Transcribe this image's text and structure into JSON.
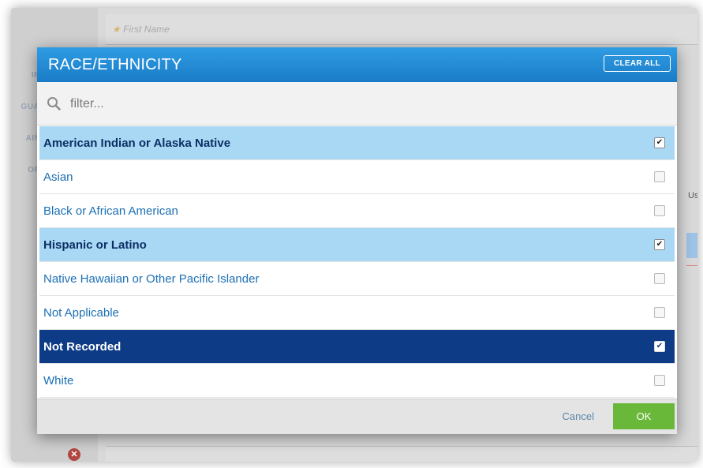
{
  "background": {
    "first_name_placeholder": "First Name",
    "sidebar_items": [
      "IFO",
      "GUAR",
      "AINT",
      "ORY"
    ],
    "side_text": "Used"
  },
  "modal": {
    "title": "RACE/ETHNICITY",
    "clear_all_label": "CLEAR ALL",
    "filter_placeholder": "filter...",
    "options": [
      {
        "label": "American Indian or Alaska Native",
        "checked": true,
        "state": "checked"
      },
      {
        "label": "Asian",
        "checked": false,
        "state": "unchecked"
      },
      {
        "label": "Black or African American",
        "checked": false,
        "state": "unchecked"
      },
      {
        "label": "Hispanic or Latino",
        "checked": true,
        "state": "checked"
      },
      {
        "label": "Native Hawaiian or Other Pacific Islander",
        "checked": false,
        "state": "unchecked"
      },
      {
        "label": "Not Applicable",
        "checked": false,
        "state": "unchecked"
      },
      {
        "label": "Not Recorded",
        "checked": true,
        "state": "active"
      },
      {
        "label": "White",
        "checked": false,
        "state": "unchecked"
      }
    ],
    "cancel_label": "Cancel",
    "ok_label": "OK"
  },
  "colors": {
    "header_blue": "#1a7cc8",
    "selected_row": "#a9d8f5",
    "active_row": "#0d3b86",
    "ok_green": "#6ab83a"
  },
  "icons": {
    "search": "search-icon",
    "checkbox": "checkbox-icon",
    "remove": "remove-icon"
  }
}
